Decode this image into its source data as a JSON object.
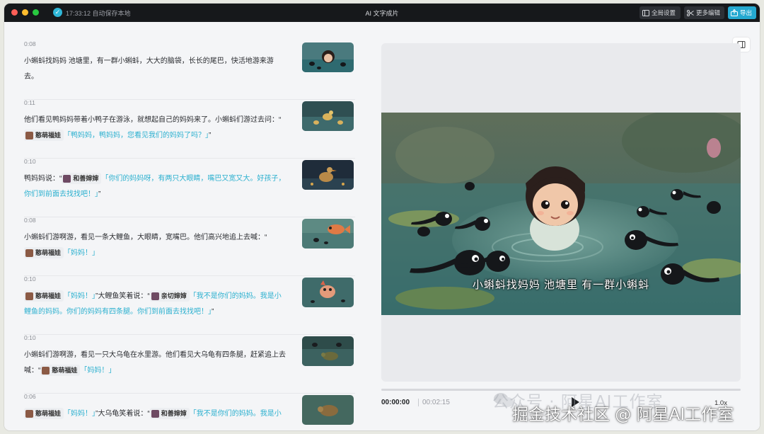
{
  "titlebar": {
    "save_status": "17:33:12 自动保存本地",
    "app_title": "AI 文字成片",
    "global_settings": "全局设置",
    "more_edit": "更多编辑",
    "export": "导出"
  },
  "scenes": [
    {
      "duration": "0:08",
      "text": "小蝌蚪找妈妈 池塘里，有一群小蝌蚪，大大的脑袋，长长的尾巴，快活地游来游去。"
    },
    {
      "duration": "0:11",
      "text_pre": "他们看见鸭妈妈带着小鸭子在游泳，就想起自己的妈妈来了。小蝌蚪们游过去问：“",
      "voice": "憨萌福娃",
      "quote": "「鸭妈妈，鸭妈妈，您看见我们的妈妈了吗？」",
      "text_post": "”"
    },
    {
      "duration": "0:10",
      "text_pre": "鸭妈妈说：“",
      "voice": "和善婶婶",
      "quote": "「你们的妈妈呀，有两只大眼睛，嘴巴又宽又大。好孩子，你们到前面去找找吧！」",
      "text_post": "”"
    },
    {
      "duration": "0:08",
      "text_pre": "小蝌蚪们游啊游，看见一条大鲤鱼，大眼睛，宽嘴巴。他们高兴地追上去喊：“",
      "voice": "憨萌福娃",
      "quote": "「妈妈！」",
      "text_post": ""
    },
    {
      "duration": "0:10",
      "voice": "憨萌福娃",
      "quote": "「妈妈！」",
      "text_mid": "”大鲤鱼笑着说：“",
      "voice2": "亲切婶婶",
      "quote2": "「我不是你们的妈妈。我是小鲤鱼的妈妈。你们的妈妈有四条腿。你们到前面去找找吧！」",
      "text_post": "”"
    },
    {
      "duration": "0:10",
      "text_pre": "小蝌蚪们游啊游，看见一只大乌龟在水里游。他们看见大乌龟有四条腿，赶紧追上去喊：“",
      "voice": "憨萌福娃",
      "quote": "「妈妈！」",
      "text_post": ""
    },
    {
      "duration": "0:06",
      "voice": "憨萌福娃",
      "quote": "「妈妈！」",
      "text_mid": "”大乌龟笑着说：“",
      "voice2": "和善婶婶",
      "quote2": "「我不是你们的妈妈。我是小",
      "text_post": ""
    }
  ],
  "preview": {
    "subtitle": "小蝌蚪找妈妈 池塘里 有一群小蝌蚪",
    "time_current": "00:00:00",
    "time_total": "00:02:15",
    "speed": "1.0x"
  },
  "watermark": {
    "line1": "公众号 · 阿星AI工作室",
    "line2": "掘金技术社区 @ 阿星AI工作室"
  },
  "colors": {
    "accent": "#25a9d1",
    "titlebar": "#16181b",
    "quote": "#2bb0cf"
  }
}
